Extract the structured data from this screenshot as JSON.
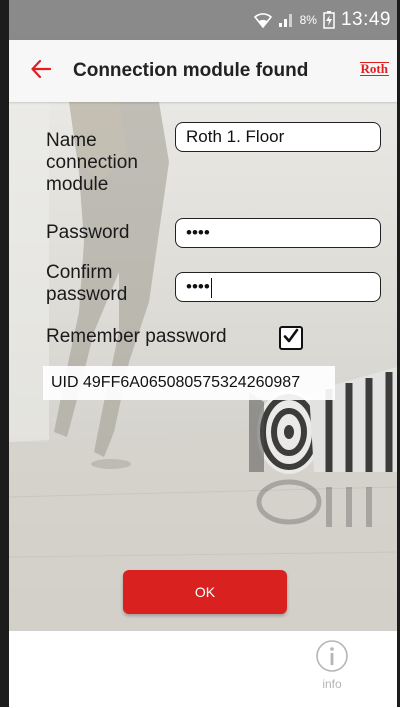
{
  "status_bar": {
    "battery_percent": "8%",
    "time": "13:49",
    "icons": [
      "wifi-icon",
      "signal-icon",
      "battery-charging-icon"
    ]
  },
  "app_bar": {
    "back_icon": "arrow-left-icon",
    "title": "Connection module found",
    "brand": "Roth"
  },
  "form": {
    "name_label": "Name connection module",
    "name_value": "Roth 1. Floor",
    "password_label": "Password",
    "password_value": "••••",
    "confirm_label": "Confirm password",
    "confirm_value": "••••",
    "remember_label": "Remember password",
    "remember_checked": true
  },
  "uid": "UID 49FF6A065080575324260987",
  "ok_button": "OK",
  "bottom_nav": {
    "info_icon": "info-icon",
    "info_label": "info"
  },
  "colors": {
    "accent": "#d9211f",
    "status_bar": "#8a8a8a",
    "app_bar": "#f7f7f7"
  }
}
